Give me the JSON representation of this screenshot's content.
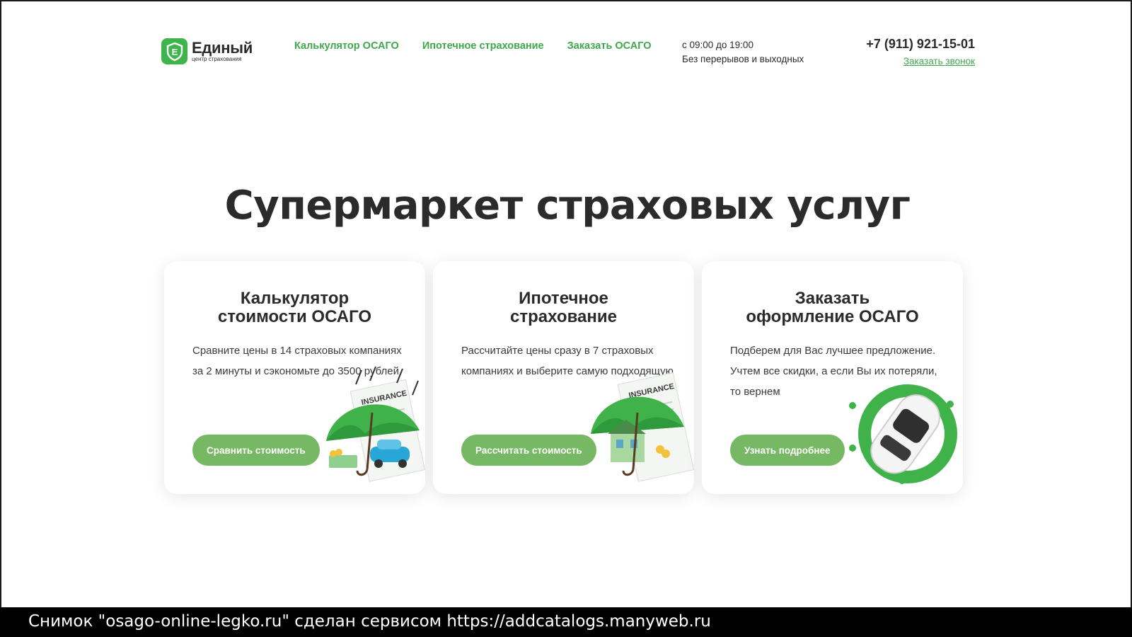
{
  "header": {
    "logo": {
      "name": "Единый",
      "subtitle": "центр страхования",
      "mark": "Е"
    },
    "nav": [
      {
        "label": "Калькулятор ОСАГО"
      },
      {
        "label": "Ипотечное страхование"
      },
      {
        "label": "Заказать ОСАГО"
      }
    ],
    "hours": {
      "time": "с 09:00 до 19:00",
      "note": "Без перерывов и выходных"
    },
    "phone": "+7 (911) 921-15-01",
    "callback_label": "Заказать звонок"
  },
  "hero": {
    "title": "Супермаркет страховых услуг"
  },
  "cards": [
    {
      "title_line1": "Калькулятор",
      "title_line2": "стоимости ОСАГО",
      "text": "Сравните цены в 14 страховых компаниях за 2 минуты и сэкономьте до 3500 рублей",
      "button": "Сравнить стоимость",
      "illustration": "umbrella-car-icon"
    },
    {
      "title_line1": "Ипотечное",
      "title_line2": "страхование",
      "text": "Рассчитайте цены сразу в 7 страховых компаниях и выберите самую подходящую",
      "button": "Рассчитать стоимость",
      "illustration": "umbrella-house-icon"
    },
    {
      "title_line1": "Заказать",
      "title_line2": "оформление ОСАГО",
      "text": "Подберем для Вас лучшее предложение. Учтем все скидки, а если Вы их потеряли, то вернем",
      "button": "Узнать подробнее",
      "illustration": "white-car-icon"
    }
  ],
  "caption": "Снимок \"osago-online-legko.ru\" сделан сервисом https://addcatalogs.manyweb.ru",
  "colors": {
    "accent": "#3fa74c",
    "button": "#76b863",
    "text": "#2b2b2b"
  }
}
